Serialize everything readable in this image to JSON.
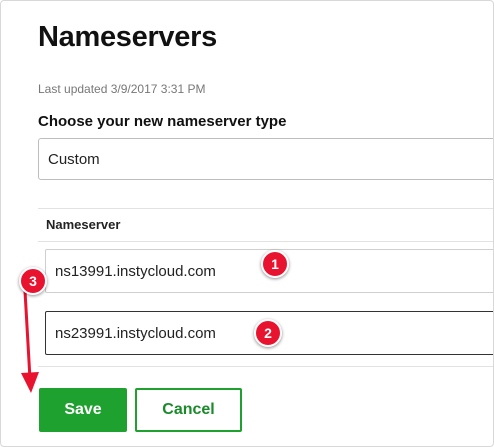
{
  "page": {
    "title": "Nameservers",
    "last_updated": "Last updated 3/9/2017 3:31 PM",
    "choose_label": "Choose your new nameserver type",
    "nameserver_type": "Custom",
    "nameserver_header": "Nameserver"
  },
  "nameservers": [
    {
      "value": "ns13991.instycloud.com",
      "active": false
    },
    {
      "value": "ns23991.instycloud.com",
      "active": true
    }
  ],
  "actions": {
    "save_label": "Save",
    "cancel_label": "Cancel"
  },
  "annotations": {
    "step1": "1",
    "step2": "2",
    "step3": "3"
  },
  "colors": {
    "accent_green": "#1fa12f",
    "annotation_red": "#e8132f"
  }
}
